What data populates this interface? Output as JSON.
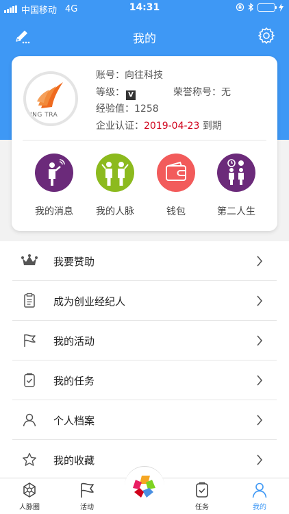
{
  "status_bar": {
    "carrier": "中国移动",
    "network": "4G",
    "time": "14:31"
  },
  "nav": {
    "title": "我的"
  },
  "profile": {
    "avatar_text": "ING TRA",
    "account_label": "账号：",
    "account_value": "向往科技",
    "level_label": "等级：",
    "level_icon": "V",
    "honor_label": "荣誉称号：",
    "honor_value": "无",
    "exp_label": "经验值：",
    "exp_value": "1258",
    "cert_label": "企业认证：",
    "cert_date": "2019-04-23",
    "cert_suffix": " 到期"
  },
  "quick_actions": [
    {
      "label": "我的消息",
      "icon": "message-person-icon",
      "color": "#6b2a7a"
    },
    {
      "label": "我的人脉",
      "icon": "contacts-people-icon",
      "color": "#8cba1e"
    },
    {
      "label": "钱包",
      "icon": "wallet-icon",
      "color": "#f25b5b"
    },
    {
      "label": "第二人生",
      "icon": "second-life-icon",
      "color": "#6b2a7a"
    }
  ],
  "menu": [
    {
      "label": "我要赞助",
      "icon": "crown-icon"
    },
    {
      "label": "成为创业经纪人",
      "icon": "clipboard-icon"
    },
    {
      "label": "我的活动",
      "icon": "flag-icon"
    },
    {
      "label": "我的任务",
      "icon": "task-check-icon"
    },
    {
      "label": "个人档案",
      "icon": "person-icon"
    },
    {
      "label": "我的收藏",
      "icon": "star-icon"
    }
  ],
  "tabs": [
    {
      "label": "人脉圈",
      "icon": "network-icon"
    },
    {
      "label": "活动",
      "icon": "flag-icon"
    },
    {
      "label": "任务",
      "icon": "task-icon"
    },
    {
      "label": "我的",
      "icon": "user-icon"
    }
  ],
  "colors": {
    "primary": "#3e98f5",
    "date_red": "#d0021b",
    "battery_green": "#54d054"
  }
}
